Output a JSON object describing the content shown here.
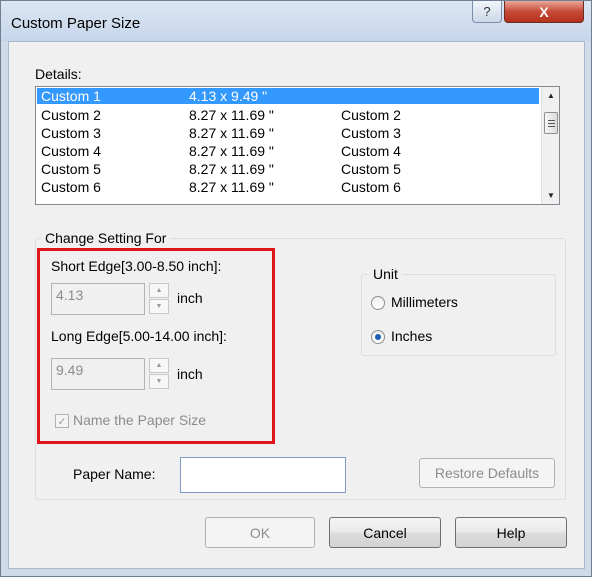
{
  "window": {
    "title": "Custom Paper Size",
    "help_glyph": "?",
    "close_glyph": "X"
  },
  "details": {
    "label": "Details:",
    "rows": [
      {
        "name": "Custom  1",
        "size": "4.13 x 9.49 \"",
        "alias": ""
      },
      {
        "name": "Custom  2",
        "size": "8.27 x 11.69 \"",
        "alias": "Custom  2"
      },
      {
        "name": "Custom  3",
        "size": "8.27 x 11.69 \"",
        "alias": "Custom  3"
      },
      {
        "name": "Custom  4",
        "size": "8.27 x 11.69 \"",
        "alias": "Custom  4"
      },
      {
        "name": "Custom  5",
        "size": "8.27 x 11.69 \"",
        "alias": "Custom  5"
      },
      {
        "name": "Custom  6",
        "size": "8.27 x 11.69 \"",
        "alias": "Custom  6"
      }
    ],
    "selected_index": 0,
    "scroll_up": "▲",
    "scroll_down": "▼"
  },
  "change_setting": {
    "label": "Change Setting For",
    "short_edge_label": "Short Edge[3.00-8.50 inch]:",
    "short_edge_value": "4.13",
    "short_edge_unit": "inch",
    "long_edge_label": "Long Edge[5.00-14.00 inch]:",
    "long_edge_value": "9.49",
    "long_edge_unit": "inch",
    "name_checkbox_label": "Name the Paper Size",
    "name_checkbox_mark": "✓",
    "spin_up": "▲",
    "spin_down": "▼"
  },
  "unit": {
    "label": "Unit",
    "millimeters": "Millimeters",
    "inches": "Inches",
    "selected": "inches"
  },
  "paper_name": {
    "label": "Paper Name:",
    "value": ""
  },
  "buttons": {
    "restore_defaults": "Restore Defaults",
    "ok": "OK",
    "cancel": "Cancel",
    "help": "Help"
  },
  "colors": {
    "selection": "#3399ff",
    "highlight_border": "#e0161b",
    "close_button": "#c74a36"
  }
}
